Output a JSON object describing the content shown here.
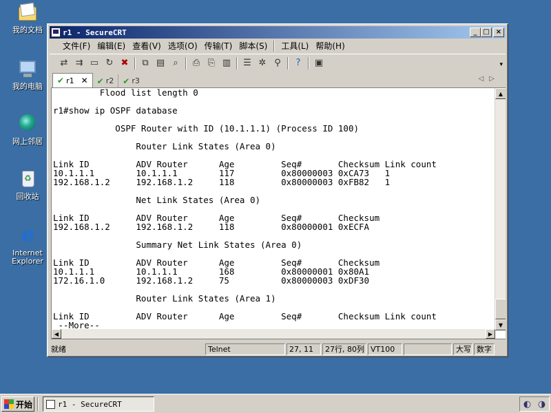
{
  "desktop": {
    "icons": [
      {
        "label": "我的文档",
        "icon": "my-documents-icon"
      },
      {
        "label": "我的电脑",
        "icon": "my-computer-icon"
      },
      {
        "label": "网上邻居",
        "icon": "network-places-icon"
      },
      {
        "label": "回收站",
        "icon": "recycle-bin-icon"
      },
      {
        "label": "Internet Explorer",
        "icon": "internet-explorer-icon"
      }
    ]
  },
  "window": {
    "title": "r1 - SecureCRT",
    "title_colors": {
      "start": "#0a246a",
      "end": "#a6caf0"
    },
    "buttons": {
      "minimize": "_",
      "maximize": "□",
      "close": "×"
    }
  },
  "menubar": {
    "items": [
      "文件(F)",
      "编辑(E)",
      "查看(V)",
      "选项(O)",
      "传输(T)",
      "脚本(S)",
      "工具(L)",
      "帮助(H)"
    ]
  },
  "toolbar": {
    "tools": [
      "connect-icon",
      "quick-connect-icon",
      "connect-tab-icon",
      "reconnect-icon",
      "disconnect-icon",
      "copy-icon",
      "paste-icon",
      "find-icon",
      "print-icon",
      "print-selection-icon",
      "print-setup-icon",
      "session-options-icon",
      "global-options-icon",
      "keymap-icon",
      "help-icon",
      "sftp-icon"
    ]
  },
  "tabs": [
    {
      "label": "r1",
      "active": true
    },
    {
      "label": "r2",
      "active": false
    },
    {
      "label": "r3",
      "active": false
    }
  ],
  "terminal": {
    "lines": [
      "         Flood list length 0",
      "",
      "r1#show ip OSPF database",
      "",
      "            OSPF Router with ID (10.1.1.1) (Process ID 100)",
      "",
      "                Router Link States (Area 0)",
      "",
      "Link ID         ADV Router      Age         Seq#       Checksum Link count",
      "10.1.1.1        10.1.1.1        117         0x80000003 0xCA73   1",
      "192.168.1.2     192.168.1.2     118         0x80000003 0xFB82   1",
      "",
      "                Net Link States (Area 0)",
      "",
      "Link ID         ADV Router      Age         Seq#       Checksum",
      "192.168.1.2     192.168.1.2     118         0x80000001 0xECFA",
      "",
      "                Summary Net Link States (Area 0)",
      "",
      "Link ID         ADV Router      Age         Seq#       Checksum",
      "10.1.1.1        10.1.1.1        168         0x80000001 0x80A1",
      "172.16.1.0      192.168.1.2     75          0x80000003 0xDF30",
      "",
      "                Router Link States (Area 1)",
      "",
      "Link ID         ADV Router      Age         Seq#       Checksum Link count",
      " --More--"
    ]
  },
  "statusbar": {
    "ready": "就绪",
    "protocol": "Telnet",
    "cursor": "27, 11",
    "size": "27行, 80列",
    "emulation": "VT100",
    "blank": "",
    "caps": "大写",
    "num": "数字"
  },
  "taskbar": {
    "start": "开始",
    "task": "r1 - SecureCRT"
  }
}
